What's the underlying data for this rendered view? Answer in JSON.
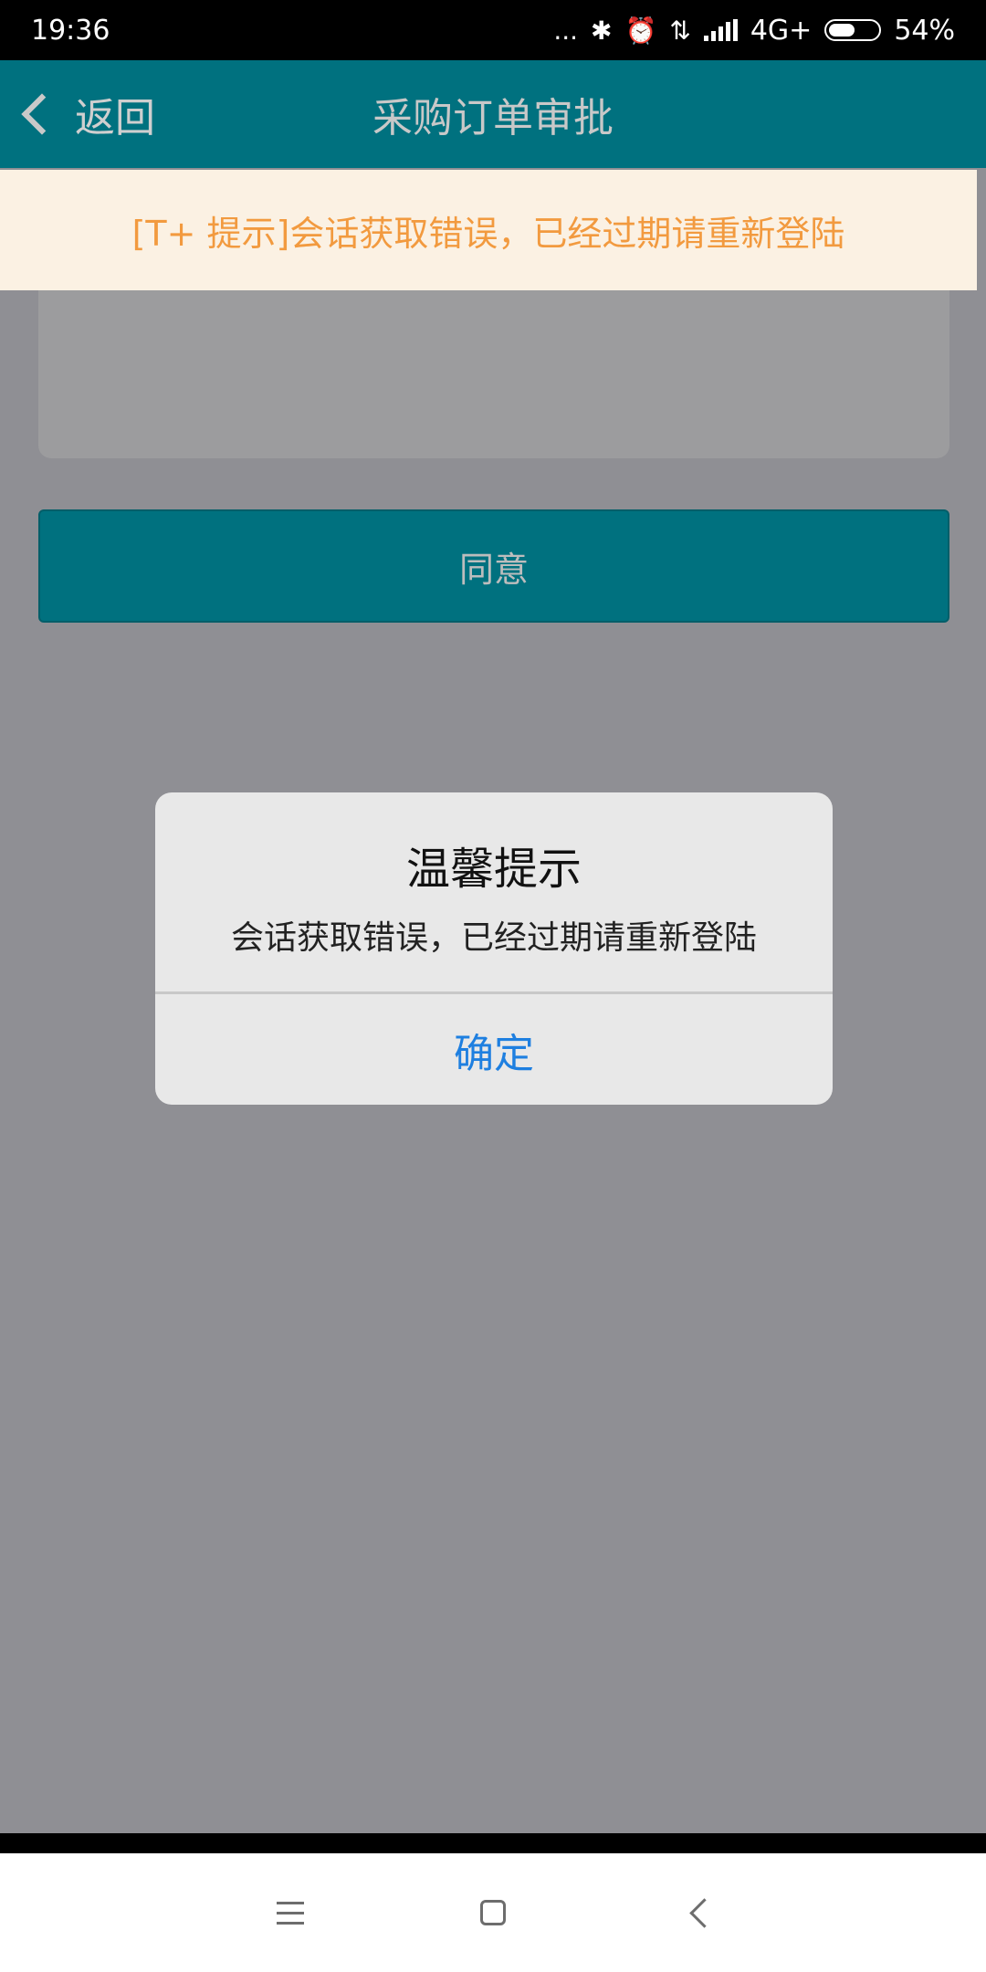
{
  "status_bar": {
    "time": "19:36",
    "dots": "...",
    "bluetooth_icon": "bluetooth-icon",
    "alarm_icon": "alarm-icon",
    "data_icon": "data-transfer-icon",
    "network": "4G+",
    "battery": "54%",
    "battery_level": 0.54
  },
  "nav_bar": {
    "back_label": "返回",
    "title": "采购订单审批"
  },
  "banner": {
    "text": "[T+ 提示]会话获取错误，已经过期请重新登陆"
  },
  "content": {
    "agree_label": "同意"
  },
  "dialog": {
    "title": "温馨提示",
    "message": "会话获取错误，已经过期请重新登陆",
    "confirm_label": "确定"
  },
  "colors": {
    "nav": "#00717f",
    "banner_text": "#f29a3f",
    "banner_bg": "#fbf1e3",
    "link": "#1e7fe0",
    "overlay": "#8f8f94"
  }
}
